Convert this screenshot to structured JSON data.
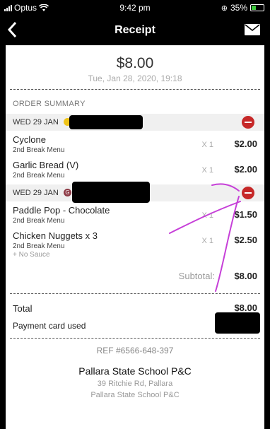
{
  "status_bar": {
    "carrier": "Optus",
    "time": "9:42 pm",
    "battery": "35%"
  },
  "nav": {
    "title": "Receipt"
  },
  "receipt": {
    "amount": "$8.00",
    "datetime": "Tue, Jan 28, 2020, 19:18",
    "section_title": "ORDER SUMMARY",
    "groups": [
      {
        "day": "WED 29 JAN",
        "badge": "",
        "items": [
          {
            "name": "Cyclone",
            "menu": "2nd Break Menu",
            "qty": "X 1",
            "price": "$2.00"
          },
          {
            "name": "Garlic Bread (V)",
            "menu": "2nd Break Menu",
            "qty": "X 1",
            "price": "$2.00"
          }
        ]
      },
      {
        "day": "WED 29 JAN",
        "badge": "G",
        "items": [
          {
            "name": "Paddle Pop - Chocolate",
            "menu": "2nd Break Menu",
            "qty": "X 1",
            "price": "$1.50"
          },
          {
            "name": "Chicken Nuggets x 3",
            "menu": "2nd Break Menu",
            "note": "+ No Sauce",
            "qty": "X 1",
            "price": "$2.50"
          }
        ]
      }
    ],
    "subtotal_label": "Subtotal:",
    "subtotal_value": "$8.00",
    "total_label": "Total",
    "total_value": "$8.00",
    "payment_label": "Payment card used",
    "ref": "REF #6566-648-397",
    "school_name": "Pallara State School P&C",
    "address": "39 Ritchie Rd, Pallara",
    "school_sub": "Pallara State School P&C"
  },
  "colors": {
    "remove_red": "#c62828",
    "annotation": "#c63fd8",
    "badge_yellow": "#f0c419",
    "badge_maroon": "#8e3b46"
  }
}
